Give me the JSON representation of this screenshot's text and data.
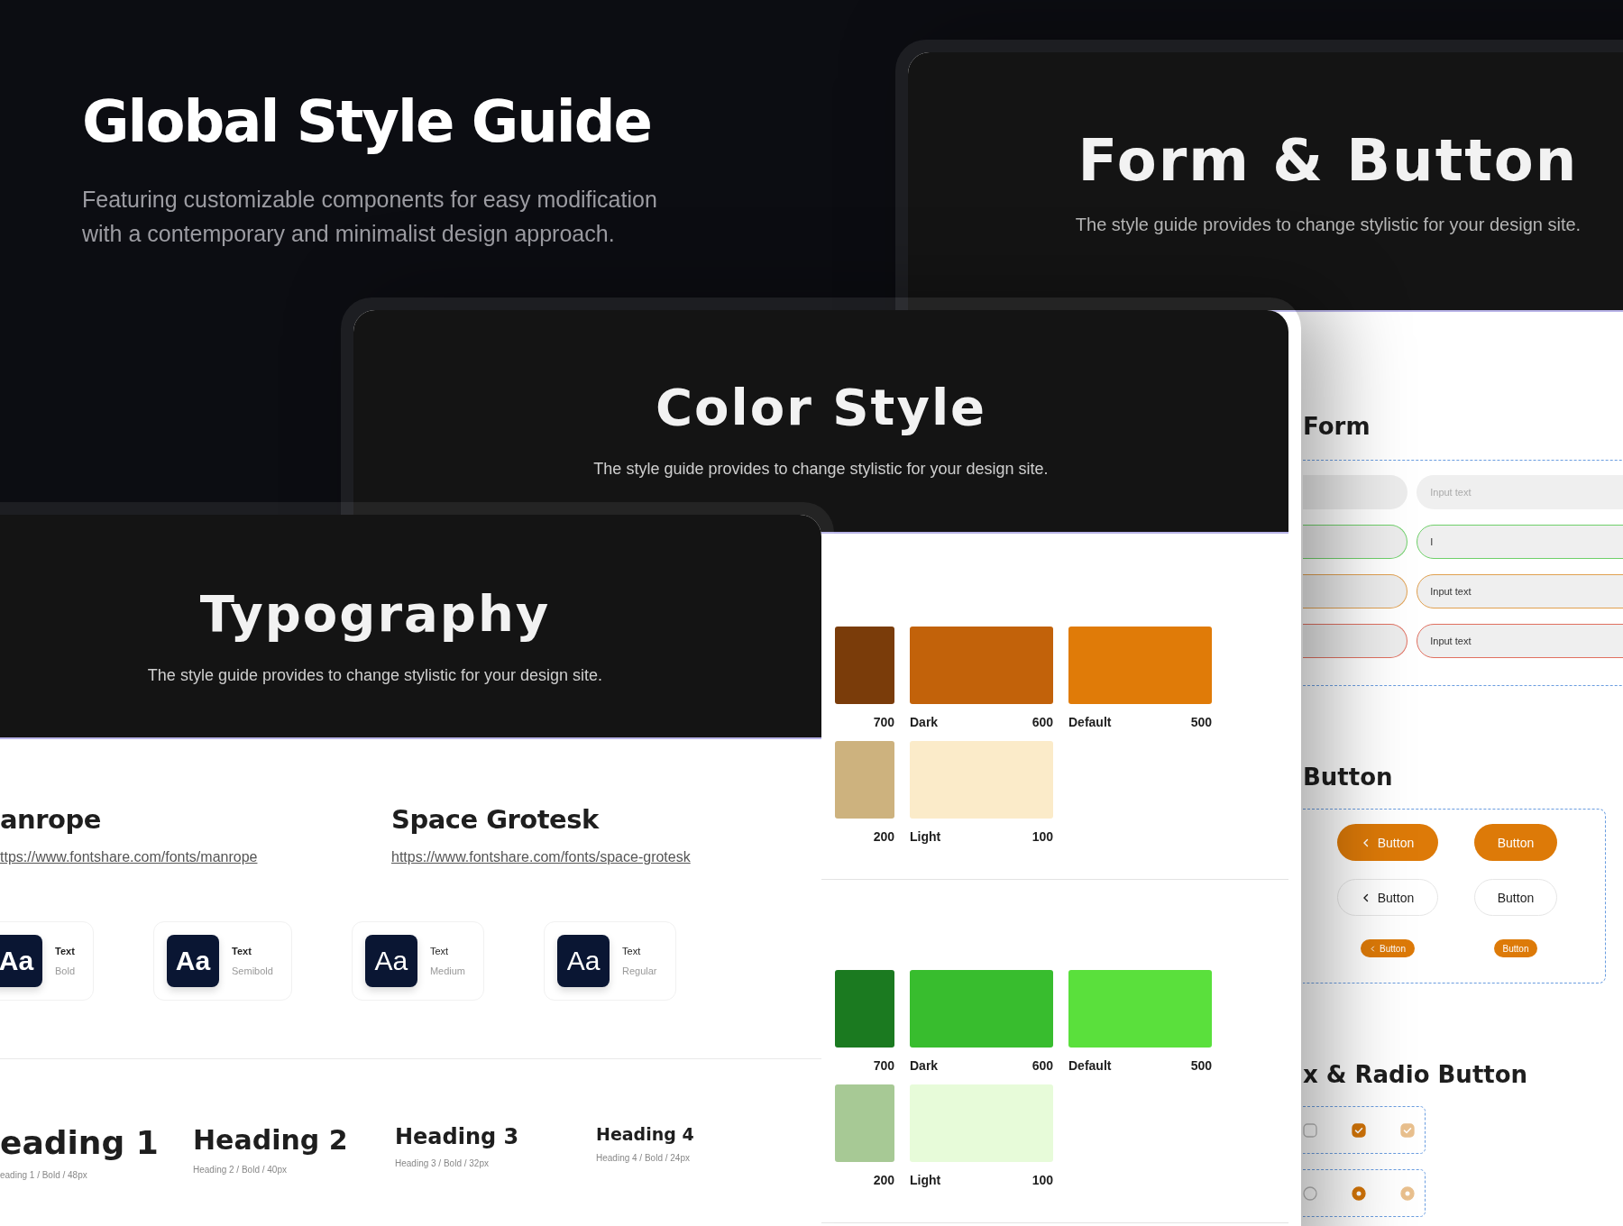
{
  "hero": {
    "title": "Global Style Guide",
    "subtitle": "Featuring customizable components for easy modification with a contemporary and minimalist design approach."
  },
  "form_button_window": {
    "title": "Form & Button",
    "subtitle": "The style guide provides to change stylistic for your design site.",
    "form": {
      "heading": "Form",
      "rows": [
        {
          "kind": "disabled",
          "input": {
            "placeholder": "Input text"
          }
        },
        {
          "kind": "focus",
          "input": {
            "value": "I"
          }
        },
        {
          "kind": "warning",
          "input": {
            "value": "Input text"
          }
        },
        {
          "kind": "error",
          "input": {
            "value": "Input text"
          }
        }
      ]
    },
    "button_section": {
      "heading": "Button",
      "buttons": [
        {
          "label": "Button",
          "kind": "filled",
          "chevron": true
        },
        {
          "label": "Button",
          "kind": "filled",
          "chevron": false
        },
        {
          "label": "Button",
          "kind": "outline",
          "chevron": true
        },
        {
          "label": "Button",
          "kind": "outline",
          "chevron": false
        },
        {
          "label": "Button",
          "kind": "small",
          "chevron": true
        },
        {
          "label": "Button",
          "kind": "small",
          "chevron": false
        }
      ]
    },
    "choice_section": {
      "heading": "x & Radio Button",
      "checkboxes": [
        {
          "checked": false,
          "disabled": false
        },
        {
          "checked": true,
          "disabled": false
        },
        {
          "checked": true,
          "disabled": true
        }
      ],
      "radios": [
        {
          "selected": false,
          "disabled": false
        },
        {
          "selected": true,
          "disabled": false
        },
        {
          "selected": true,
          "disabled": true
        }
      ]
    }
  },
  "color_window": {
    "title": "Color Style",
    "subtitle": "The style guide provides to change stylistic for your design site.",
    "palettes": [
      {
        "rows": [
          [
            {
              "number": "700",
              "color": "#7a3c0a"
            },
            {
              "name": "Dark",
              "number": "600",
              "color": "#c2620a"
            },
            {
              "name": "Default",
              "number": "500",
              "color": "#e07b08"
            }
          ],
          [
            {
              "number": "200",
              "color": "#cdb27e"
            },
            {
              "name": "Light",
              "number": "100",
              "color": "#fbebc9"
            }
          ]
        ]
      },
      {
        "rows": [
          [
            {
              "number": "700",
              "color": "#1b7a20"
            },
            {
              "name": "Dark",
              "number": "600",
              "color": "#38bd2e"
            },
            {
              "name": "Default",
              "number": "500",
              "color": "#5ae03c"
            }
          ],
          [
            {
              "number": "200",
              "color": "#a7c995"
            },
            {
              "name": "Light",
              "number": "100",
              "color": "#e7fbd9"
            }
          ]
        ]
      }
    ]
  },
  "typography_window": {
    "title": "Typography",
    "subtitle": "The style guide provides to change stylistic for your design site.",
    "fonts": [
      {
        "name": "anrope",
        "link": "ttps://www.fontshare.com/fonts/manrope"
      },
      {
        "name": "Space Grotesk",
        "link": "https://www.fontshare.com/fonts/space-grotesk"
      }
    ],
    "weights": [
      {
        "sample": "Aa",
        "label": "Text",
        "name": "Bold",
        "kind": "bold"
      },
      {
        "sample": "Aa",
        "label": "Text",
        "name": "Semibold",
        "kind": "semibold"
      },
      {
        "sample": "Aa",
        "label": "Text",
        "name": "Medium",
        "kind": "medium"
      },
      {
        "sample": "Aa",
        "label": "Text",
        "name": "Regular",
        "kind": "regular"
      }
    ],
    "headings": [
      {
        "title": "eading 1",
        "spec": "eading 1 / Bold / 48px",
        "kind": "h1"
      },
      {
        "title": "Heading 2",
        "spec": "Heading 2 / Bold / 40px",
        "kind": "h2"
      },
      {
        "title": "Heading 3",
        "spec": "Heading 3 / Bold / 32px",
        "kind": "h3"
      },
      {
        "title": "Heading 4",
        "spec": "Heading 4 / Bold / 24px",
        "kind": "h4"
      }
    ]
  }
}
